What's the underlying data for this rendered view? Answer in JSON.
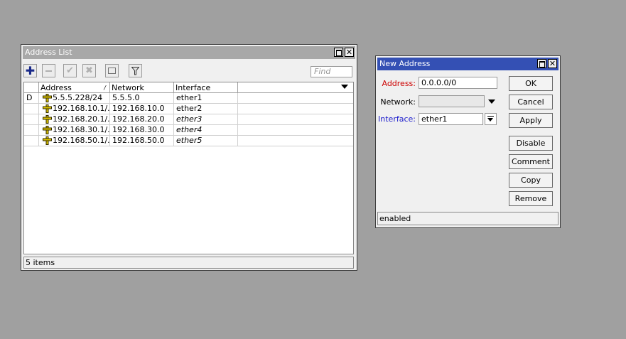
{
  "address_list": {
    "title": "Address List",
    "find_placeholder": "Find",
    "columns": [
      "Address",
      "Network",
      "Interface"
    ],
    "sort_mark": "/",
    "rows": [
      {
        "flag": "D",
        "address": "5.5.5.228/24",
        "network": "5.5.5.0",
        "interface": "ether1",
        "italic": false
      },
      {
        "flag": "",
        "address": "192.168.10.1/...",
        "network": "192.168.10.0",
        "interface": "ether2",
        "italic": false
      },
      {
        "flag": "",
        "address": "192.168.20.1/...",
        "network": "192.168.20.0",
        "interface": "ether3",
        "italic": true
      },
      {
        "flag": "",
        "address": "192.168.30.1/...",
        "network": "192.168.30.0",
        "interface": "ether4",
        "italic": true
      },
      {
        "flag": "",
        "address": "192.168.50.1/...",
        "network": "192.168.50.0",
        "interface": "ether5",
        "italic": true
      }
    ],
    "status": "5 items",
    "toolbar_icons": [
      "add-icon",
      "remove-icon",
      "enable-icon",
      "disable-icon",
      "comment-icon",
      "filter-icon"
    ]
  },
  "new_address": {
    "title": "New Address",
    "address_label": "Address:",
    "address_value": "0.0.0.0/0",
    "network_label": "Network:",
    "network_value": "",
    "interface_label": "Interface:",
    "interface_value": "ether1",
    "buttons": {
      "ok": "OK",
      "cancel": "Cancel",
      "apply": "Apply",
      "disable": "Disable",
      "comment": "Comment",
      "copy": "Copy",
      "remove": "Remove"
    },
    "status": "enabled"
  },
  "colors": {
    "desktop": "#a0a0a0",
    "active_title": "#3450b4",
    "inactive_title": "#a8a8a8",
    "address_label": "#cc0000",
    "interface_label": "#1a1acc",
    "add_icon": "#1a2a8a",
    "addr_icon": "#c8b400"
  }
}
